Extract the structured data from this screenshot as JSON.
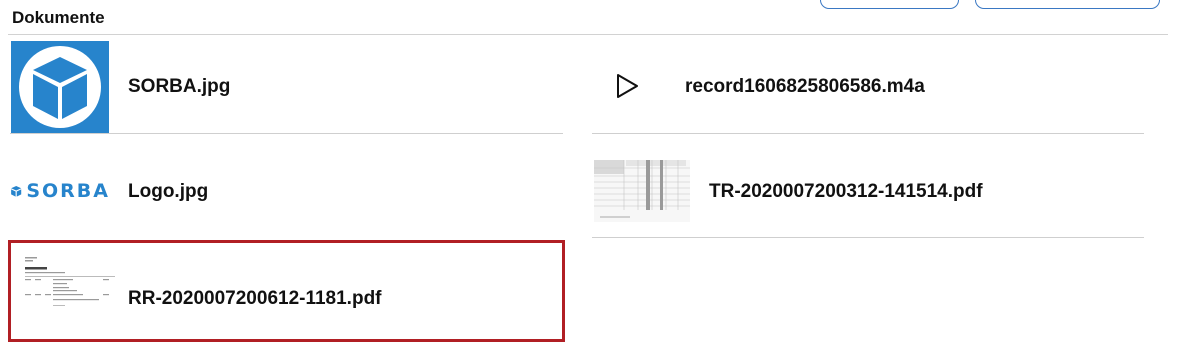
{
  "section": {
    "title": "Dokumente"
  },
  "colors": {
    "accent": "#2784cc",
    "selection": "#b11f24",
    "divider": "#cfcfcf"
  },
  "documents": [
    {
      "name": "SORBA.jpg",
      "thumbnail": "sorba-cube-image"
    },
    {
      "name": "record1606825806586.m4a",
      "thumbnail": "play-icon"
    },
    {
      "name": "Logo.jpg",
      "thumbnail": "sorba-logo-image",
      "logo_text": "SORBA"
    },
    {
      "name": "TR-2020007200312-141514.pdf",
      "thumbnail": "spreadsheet-pdf-preview"
    },
    {
      "name": "RR-2020007200612-1181.pdf",
      "thumbnail": "report-pdf-preview",
      "selected": true
    }
  ]
}
